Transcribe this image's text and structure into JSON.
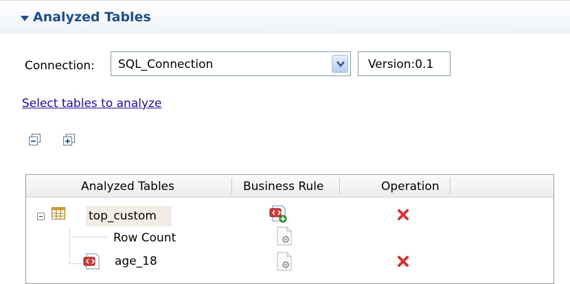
{
  "section": {
    "title": "Analyzed Tables"
  },
  "connection": {
    "label": "Connection:",
    "selected": "SQL_Connection",
    "version": "Version:0.1"
  },
  "select_link": "Select tables to analyze",
  "toolbar": {
    "collapse_icon": "collapse-all-icon",
    "expand_icon": "expand-all-icon"
  },
  "tree": {
    "columns": [
      "Analyzed Tables",
      "Business Rule",
      "Operation"
    ],
    "root": {
      "name": "top_custom",
      "icon": "table-icon"
    },
    "children": [
      {
        "name": "Row Count",
        "icon": "none"
      },
      {
        "name": "age_18",
        "icon": "business-rule-icon"
      }
    ]
  },
  "colors": {
    "header_title": "#1f4e8c",
    "link": "#1a0dab",
    "delete": "#e03030"
  }
}
